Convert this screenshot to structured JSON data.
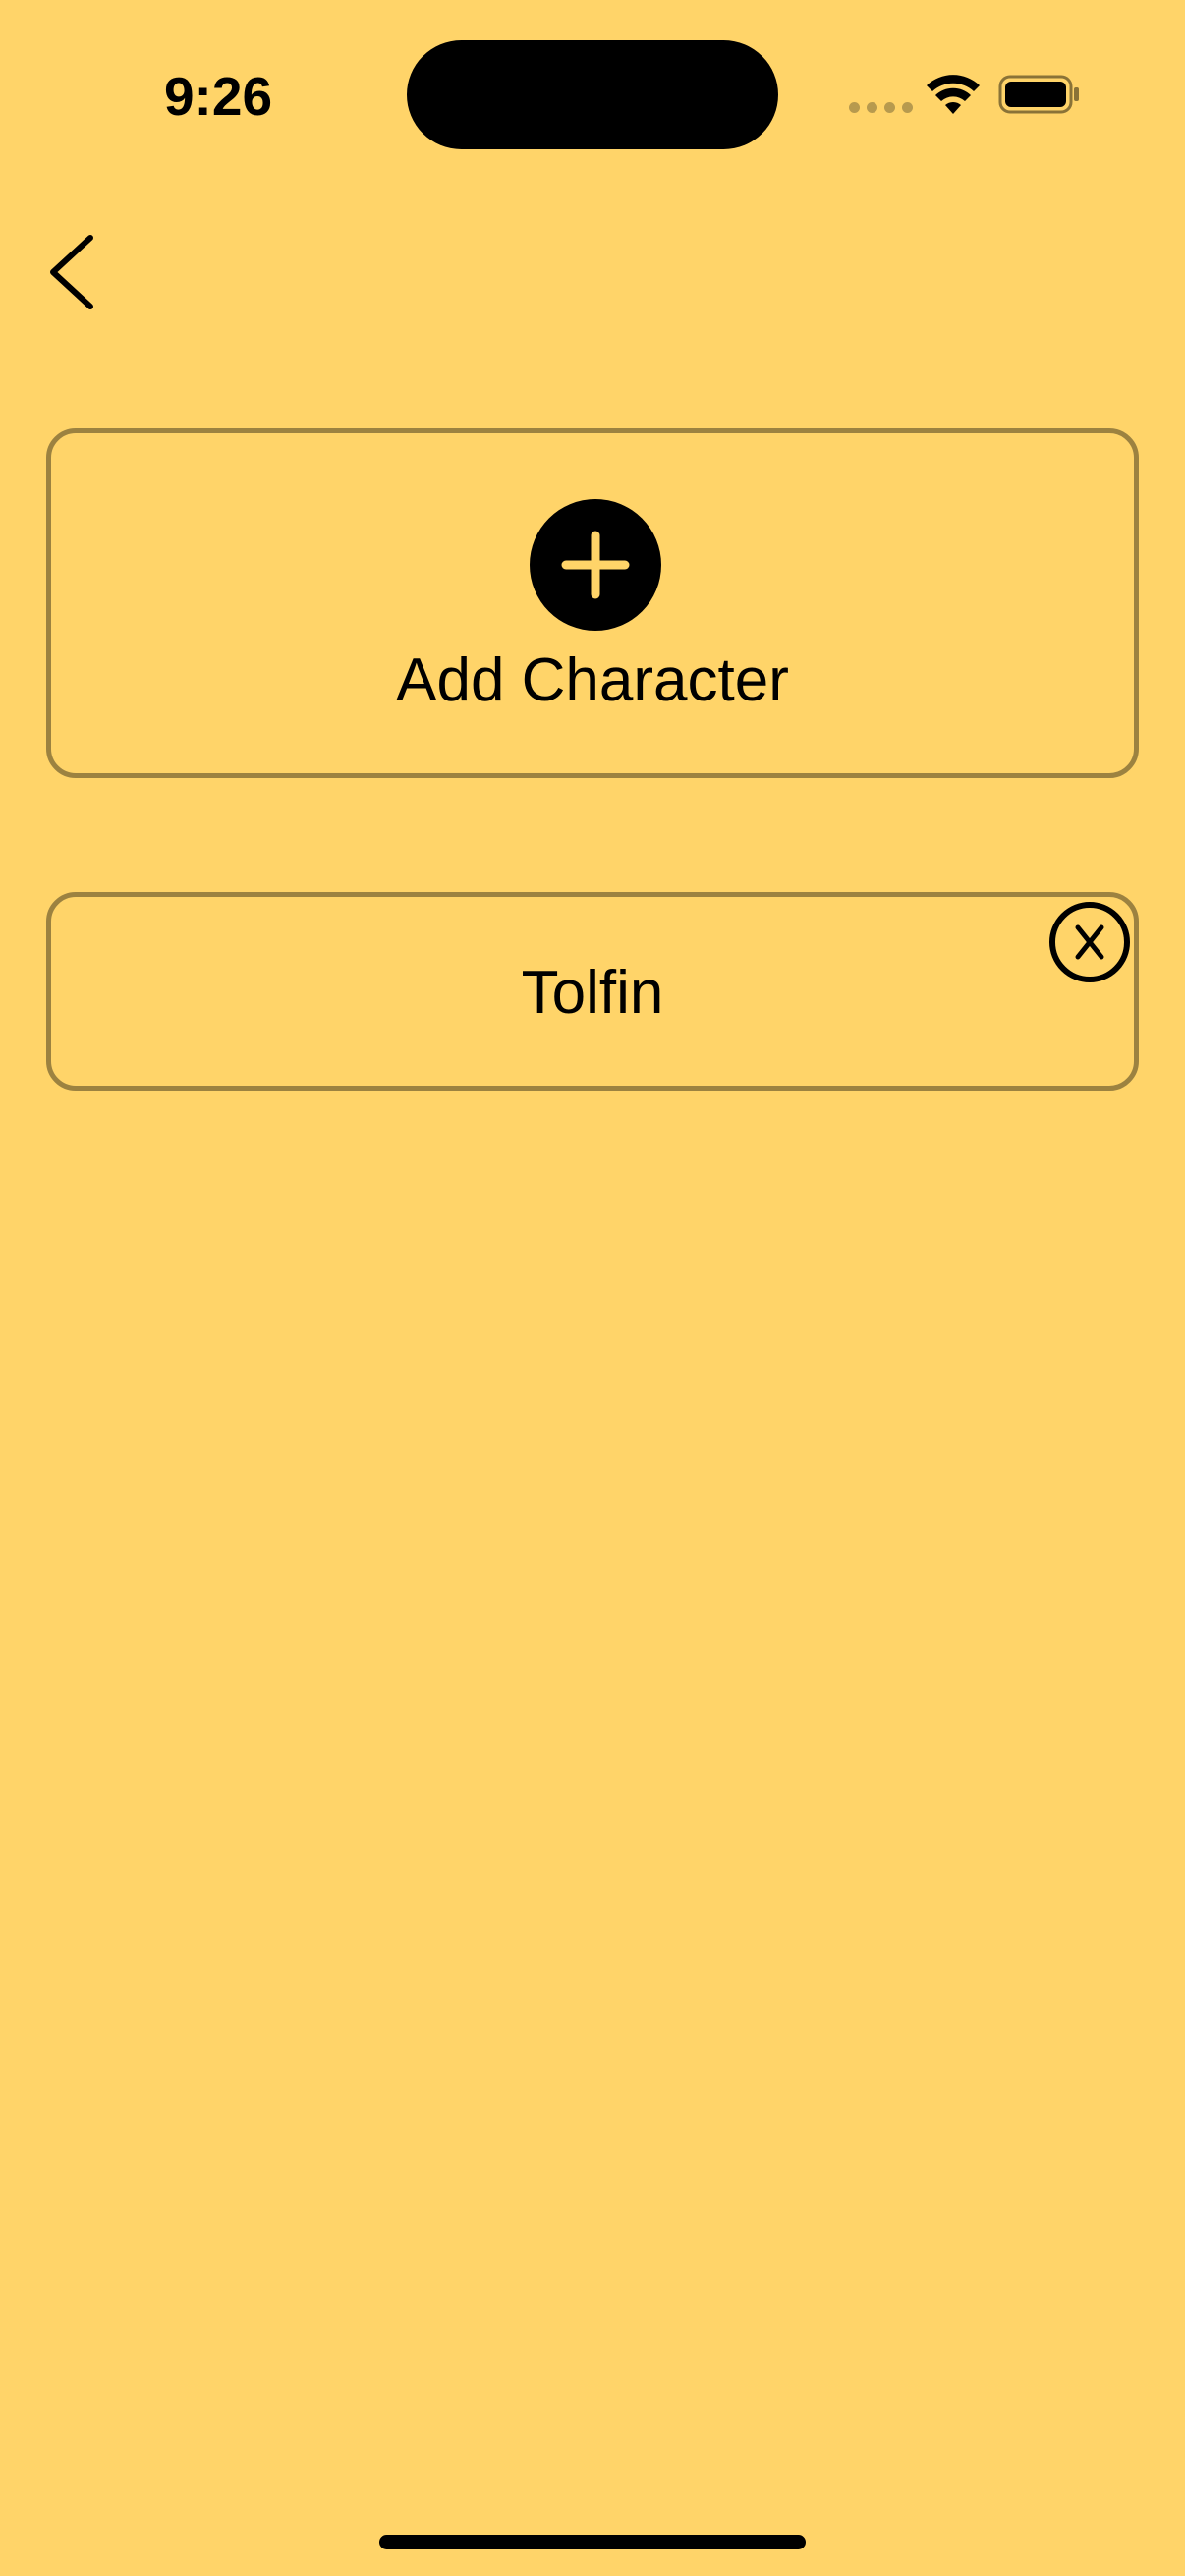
{
  "status_bar": {
    "time": "9:26"
  },
  "navigation": {
    "back_icon": "chevron-left-icon"
  },
  "add_character": {
    "label": "Add Character",
    "icon": "plus-circle-icon"
  },
  "characters": [
    {
      "name": "Tolfin",
      "remove_icon": "x-circle-icon"
    }
  ],
  "colors": {
    "background": "#FFD469",
    "card_border": "#9C8240",
    "foreground": "#000000"
  }
}
